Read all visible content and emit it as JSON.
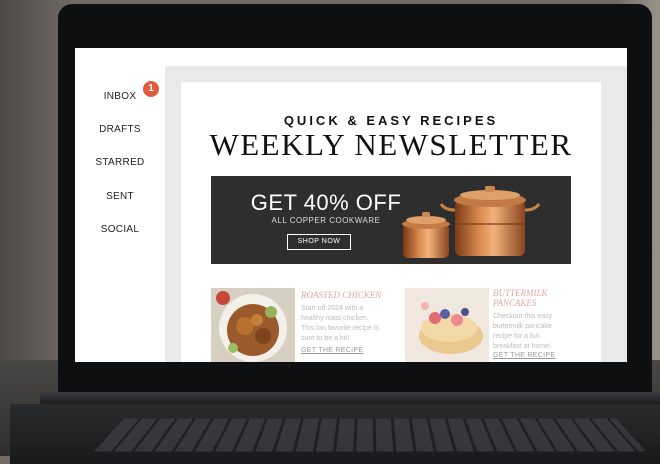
{
  "sidebar": {
    "items": [
      {
        "label": "INBOX"
      },
      {
        "label": "DRAFTS"
      },
      {
        "label": "STARRED"
      },
      {
        "label": "SENT"
      },
      {
        "label": "SOCIAL"
      }
    ],
    "inbox_badge": "1"
  },
  "newsletter": {
    "kicker": "QUICK & EASY RECIPES",
    "headline": "WEEKLY NEWSLETTER",
    "banner": {
      "offer": "GET 40% OFF",
      "subtitle": "ALL COPPER COOKWARE",
      "button": "SHOP NOW"
    },
    "recipes": [
      {
        "title": "ROASTED CHICKEN",
        "lines": [
          "Start off 2024 with a",
          "healthy roast chicken.",
          "This fan favorite recipe is",
          "sure to be a hit!"
        ],
        "link": "GET THE RECIPE"
      },
      {
        "title_lines": [
          "BUTTERMILK",
          "PANCAKES"
        ],
        "lines": [
          "Checkout this easy",
          "buttermilk pancake",
          "recipe for a fun",
          "breakfast at home!"
        ],
        "link": "GET THE RECIPE"
      }
    ]
  },
  "colors": {
    "badge": "#e05b3e",
    "banner_bg": "#2e2e2f",
    "recipe_title": "#e5a5a0"
  }
}
